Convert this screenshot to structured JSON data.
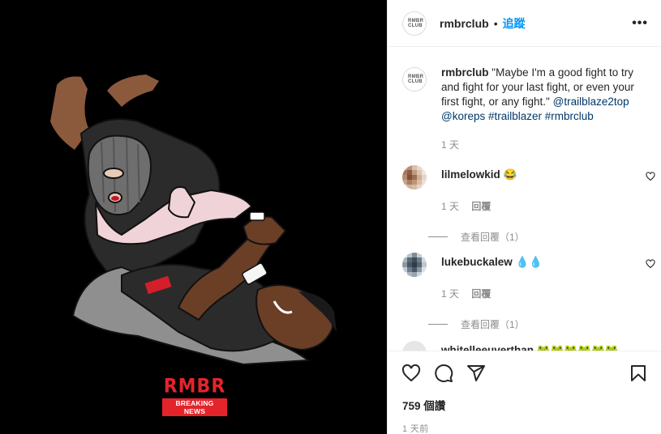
{
  "media": {
    "brand_logo": "RMBR",
    "brand_sub": "BREAKING NEWS"
  },
  "header": {
    "avatar_text": "RMBR CLUB",
    "username": "rmbrclub",
    "separator": "•",
    "follow_label": "追蹤",
    "more_label": "•••"
  },
  "caption": {
    "username": "rmbrclub",
    "text": "\"Maybe I'm a good fight to try and fight for your last fight, or even your first fight, or any fight.\"",
    "mentions": [
      "@trailblaze2top",
      "@koreps"
    ],
    "hashtags": [
      "#trailblazer",
      "#rmbrclub"
    ],
    "time": "1 天"
  },
  "comments": [
    {
      "username": "lilmelowkid",
      "emoji": "😂",
      "time": "1 天",
      "reply_label": "回覆",
      "view_replies": "查看回覆（1）",
      "avatar_colors": [
        "#c9a48a",
        "#b88f75",
        "#d8bfae",
        "#e8d8cc",
        "#f2ebe5",
        "#a87a5f",
        "#8a5d44",
        "#c29a80",
        "#dcc4b3",
        "#efe3da",
        "#b58c70",
        "#7b5039",
        "#9c6d52",
        "#cfae97",
        "#e6d5c8",
        "#c8a286",
        "#a97d61",
        "#bf9578",
        "#d9bca7",
        "#ece0d6",
        "#e1cdbd",
        "#cfb29c",
        "#d6bba6",
        "#e5d3c5",
        "#f4ece6"
      ]
    },
    {
      "username": "lukebuckalew",
      "emoji": "💧💧",
      "time": "1 天",
      "reply_label": "回覆",
      "view_replies": "查看回覆（1）",
      "avatar_colors": [
        "#dfe4e8",
        "#b9c2ca",
        "#7d8b97",
        "#c6ced5",
        "#eef1f3",
        "#a9b4bd",
        "#5a6a78",
        "#3e4d5b",
        "#6d7c89",
        "#d2d9de",
        "#8a98a4",
        "#4a5866",
        "#2f3d4a",
        "#56656f",
        "#bcc6ce",
        "#c2cbd2",
        "#6f7f8c",
        "#48586a",
        "#8896a2",
        "#dbe1e6",
        "#eaeef1",
        "#aab5be",
        "#96a3ae",
        "#cbd3d9",
        "#f3f5f7"
      ]
    }
  ],
  "partial_comment": {
    "username": "whitelleeuverthan",
    "emoji": "🐸🐸🐸🐸🐸🐸"
  },
  "actions": {
    "likes": "759 個讚",
    "posted_ago": "1 天前"
  }
}
